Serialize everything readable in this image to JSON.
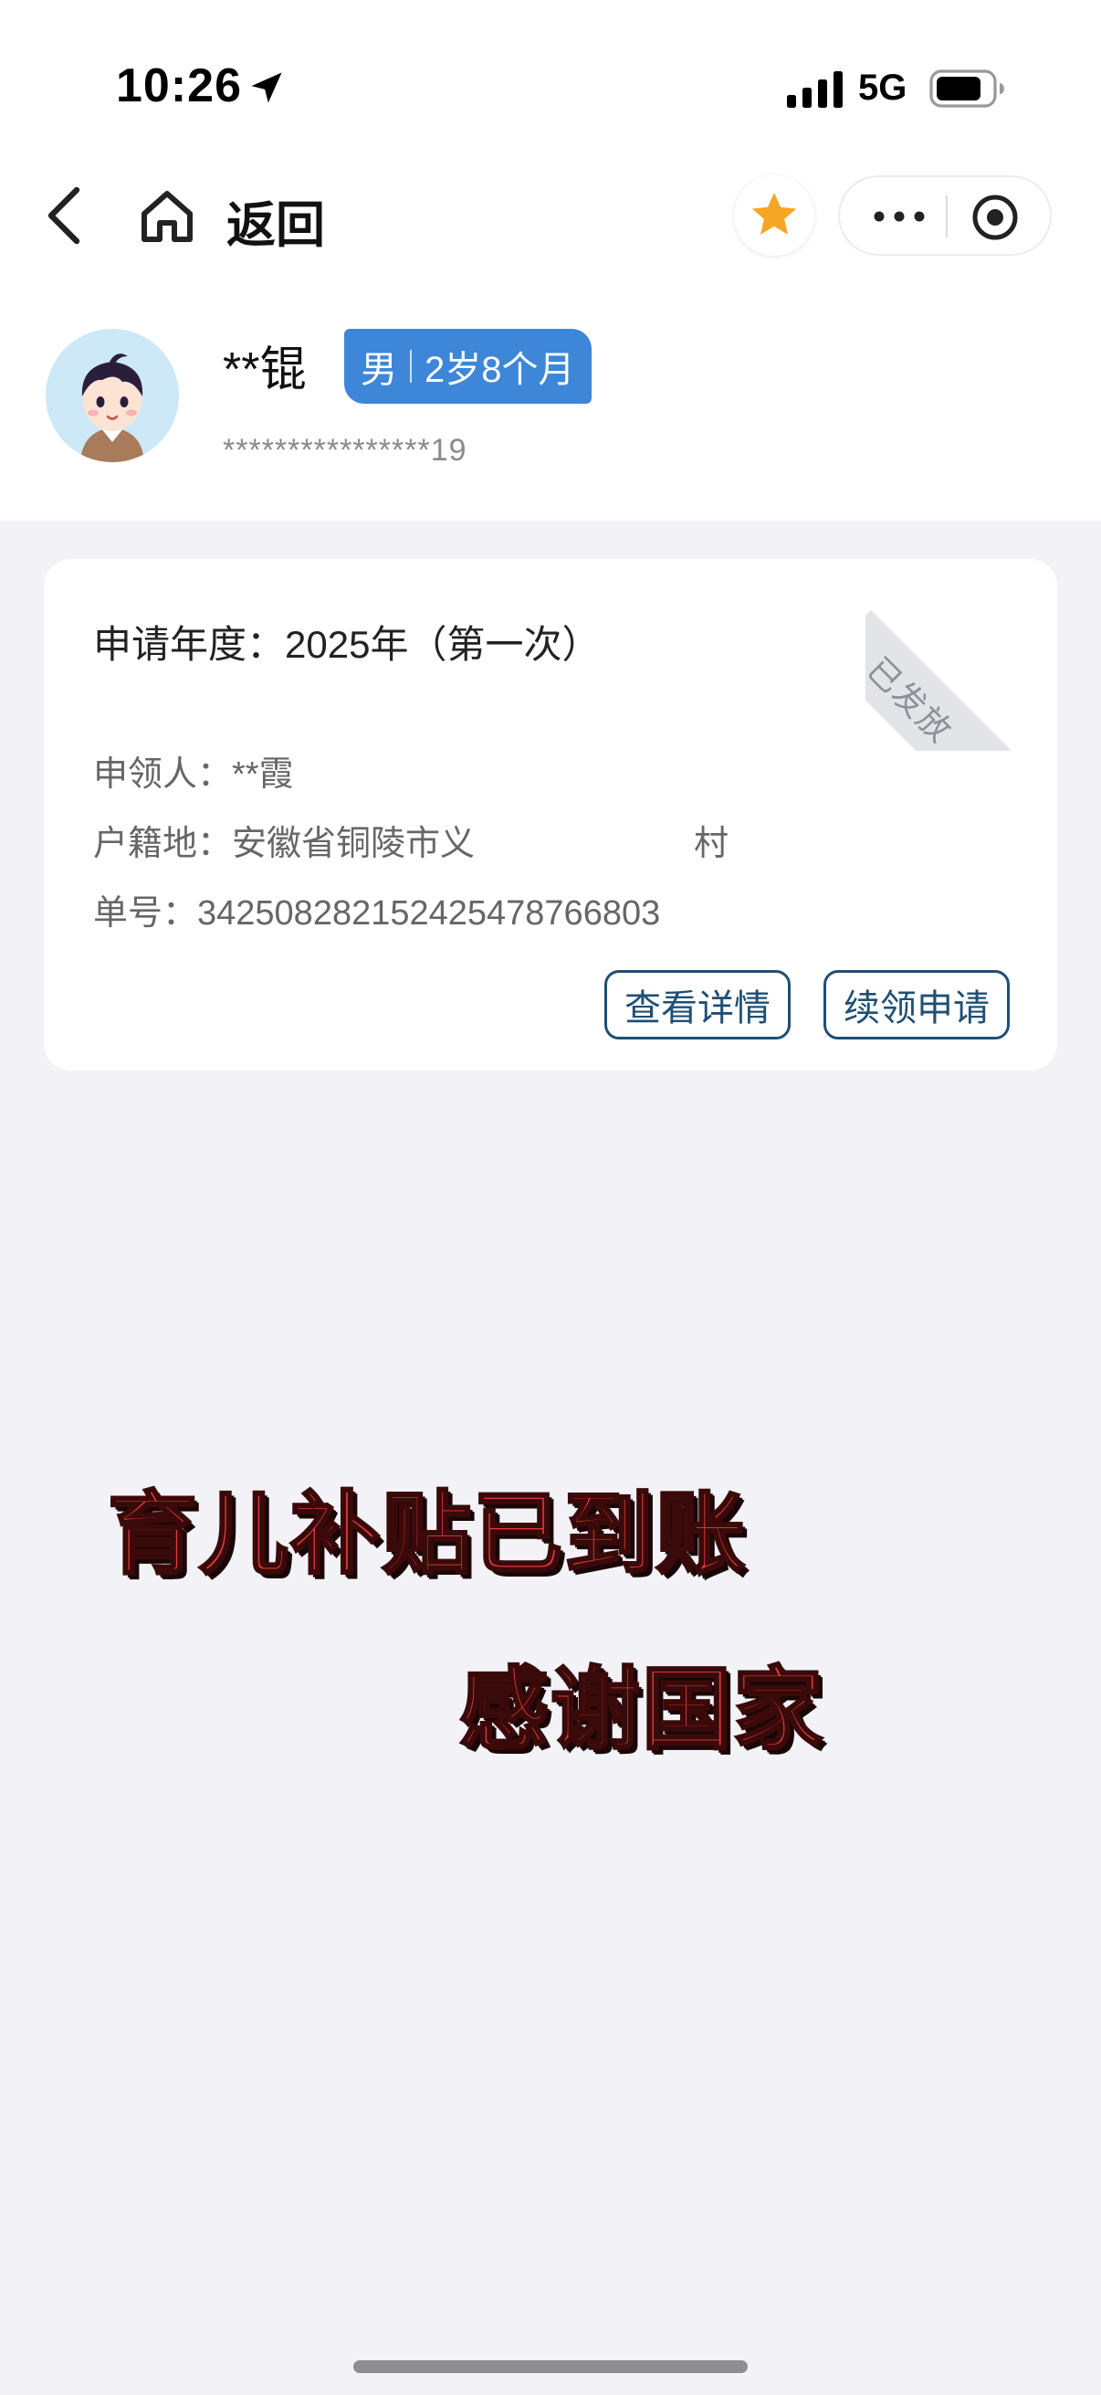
{
  "status_bar": {
    "time": "10:26",
    "network": "5G",
    "icons": [
      "location-arrow-icon",
      "signal-bars-icon",
      "battery-icon"
    ]
  },
  "nav": {
    "back_icon": "chevron-left-icon",
    "home_icon": "home-icon",
    "title": "返回",
    "favorite_icon": "star-icon",
    "more_icon": "ellipsis-icon",
    "close_icon": "target-icon"
  },
  "profile": {
    "name": "**锟",
    "gender": "男",
    "age": "2岁8个月",
    "id_number": "****************19"
  },
  "card": {
    "status": "已发放",
    "year_label": "申请年度：",
    "year_value": "2025年（第一次）",
    "applicant_label": "申领人：",
    "applicant_value": "**霞",
    "household_label": "户籍地：",
    "household_value": "安徽省铜陵市义",
    "household_tail": "村",
    "number_label": "单号：",
    "number_value": "342508282152425478766803",
    "detail_button": "查看详情",
    "renew_button": "续领申请"
  },
  "caption": {
    "line1": "育儿补贴已到账",
    "line2": "感谢国家"
  },
  "colors": {
    "accent_blue": "#3d86d8",
    "button_border": "#1f4f74",
    "star_orange": "#f5a623",
    "caption_red": "#e23c3c",
    "page_bg": "#f2f2f7"
  }
}
